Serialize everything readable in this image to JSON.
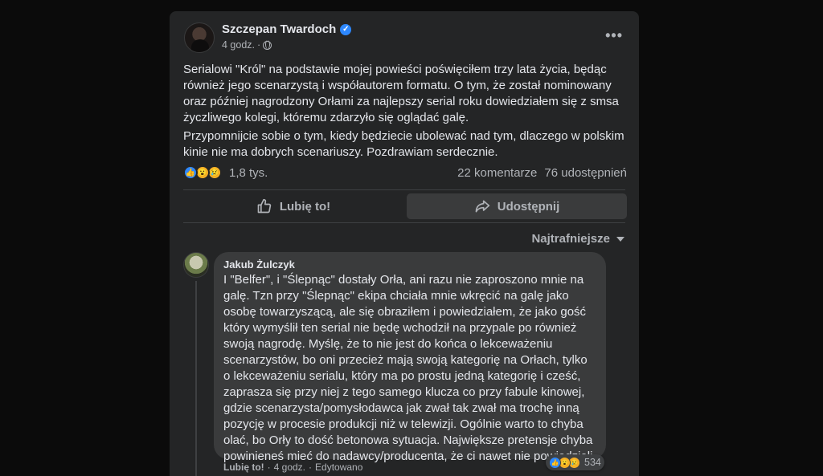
{
  "post": {
    "author": "Szczepan Twardoch",
    "time": "4 godz.",
    "separator": "·",
    "more_label": "•••",
    "paragraph1": "Serialowi \"Król\" na podstawie mojej powieści poświęciłem trzy lata życia, będąc również jego scenarzystą i współautorem formatu. O tym, że został nominowany oraz później nagrodzony Orłami za najlepszy serial roku dowiedziałem się z smsa życzliwego kolegi, któremu zdarzyło się oglądać galę.",
    "paragraph2": "Przypomnijcie sobie o tym, kiedy będziecie ubolewać nad tym, dlaczego w polskim kinie nie ma dobrych scenariuszy. Pozdrawiam serdecznie.",
    "reaction_count": "1,8 tys.",
    "comments": "22 komentarze",
    "shares": "76 udostępnień",
    "like_button": "Lubię to!",
    "share_button": "Udostępnij",
    "sort_label": "Najtrafniejsze"
  },
  "comment": {
    "author": "Jakub Żulczyk",
    "text": "I \"Belfer\", i \"Ślepnąc\" dostały Orła, ani razu nie zaproszono mnie na galę. Tzn przy \"Ślepnąc\" ekipa chciała mnie wkręcić na galę jako osobę towarzyszącą, ale się obraziłem i powiedziałem, że jako gość który wymyślił ten serial nie będę wchodził na przypale po również swoją nagrodę. Myślę, że to nie jest do końca o lekceważeniu scenarzystów, bo oni przecież mają swoją kategorię na Orłach, tylko o lekceważeniu serialu, który ma po prostu jedną kategorię i cześć, zaprasza się przy niej z tego samego klucza co przy fabule kinowej, gdzie scenarzysta/pomysłodawca jak zwał tak zwał ma trochę inną pozycję w procesie produkcji niż w telewizji. Ogólnie warto to chyba olać, bo Orły to dość betonowa sytuacja. Największe pretensje chyba powinieneś mieć do nadawcy/producenta, że ci nawet nie powiedzieli.",
    "reaction_count": "534",
    "like_label": "Lubię to!",
    "time": "4 godz.",
    "edited": "Edytowano",
    "sep1": "·",
    "sep2": "·"
  },
  "colors": {
    "background": "#0b0b0b",
    "card": "#242526",
    "bubble": "#3a3b3c",
    "accent": "#2d88ff"
  }
}
